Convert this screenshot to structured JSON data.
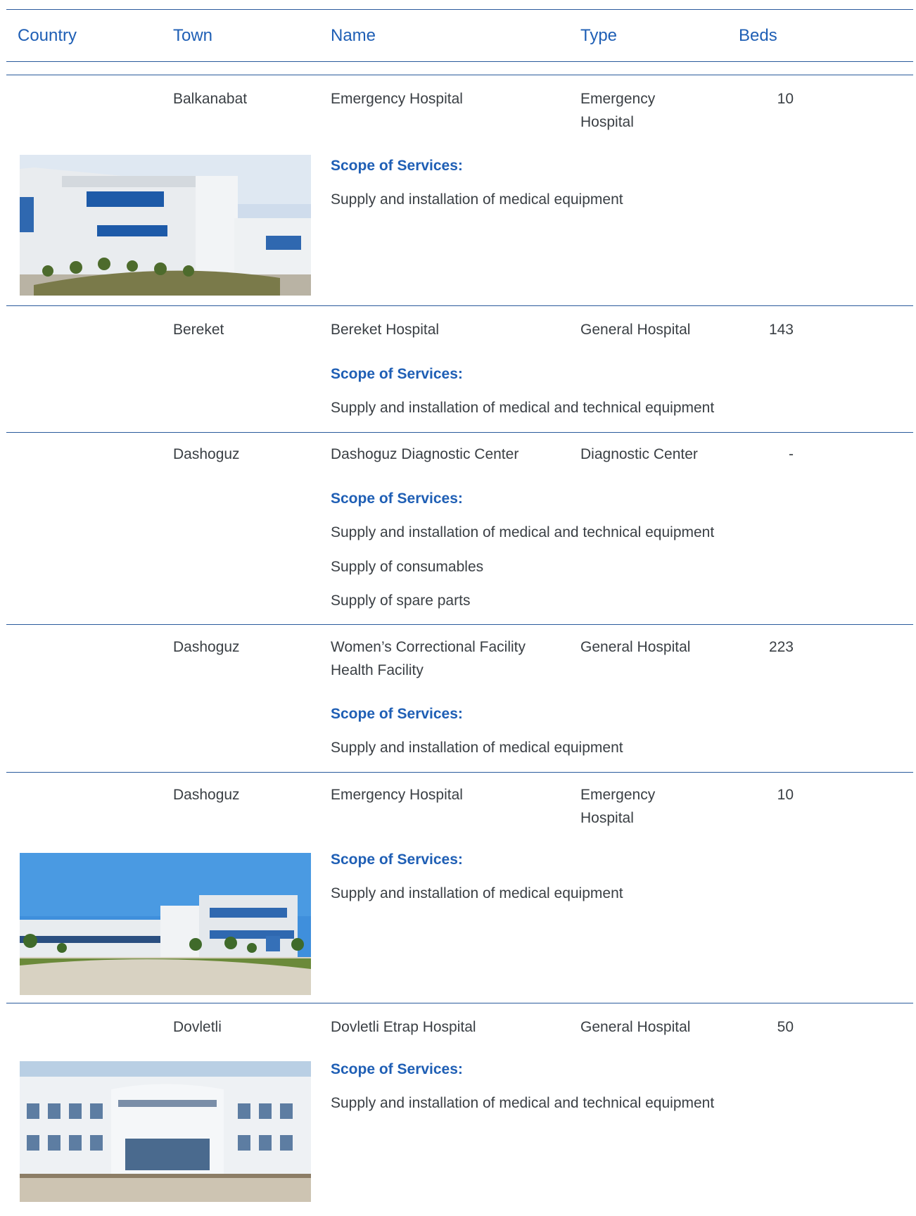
{
  "header": {
    "country": "Country",
    "town": "Town",
    "name": "Name",
    "type": "Type",
    "beds": "Beds"
  },
  "scope_heading": "Scope of Services:",
  "rows": [
    {
      "town": "Balkanabat",
      "name": "Emergency Hospital",
      "type": "Emergency Hospital",
      "beds": "10",
      "services": [
        "Supply and installation of medical equipment"
      ],
      "has_photo": true
    },
    {
      "town": "Bereket",
      "name": "Bereket Hospital",
      "type": "General Hospital",
      "beds": "143",
      "services": [
        "Supply and installation of medical and technical equipment"
      ],
      "has_photo": false
    },
    {
      "town": "Dashoguz",
      "name": "Dashoguz Diagnostic Center",
      "type": "Diagnostic Center",
      "beds": "-",
      "services": [
        "Supply and installation of medical and technical equipment",
        "Supply of consumables",
        "Supply of spare parts"
      ],
      "has_photo": false
    },
    {
      "town": "Dashoguz",
      "name": "Women’s Correctional Facility Health Facility",
      "type": "General Hospital",
      "beds": "223",
      "services": [
        "Supply and installation of medical equipment"
      ],
      "has_photo": false
    },
    {
      "town": "Dashoguz",
      "name": "Emergency Hospital",
      "type": "Emergency Hospital",
      "beds": "10",
      "services": [
        "Supply and installation of medical equipment"
      ],
      "has_photo": true
    },
    {
      "town": "Dovletli",
      "name": "Dovletli Etrap Hospital",
      "type": "General Hospital",
      "beds": "50",
      "services": [
        "Supply and installation of medical and technical equipment"
      ],
      "has_photo": true
    }
  ],
  "colors": {
    "accent": "#1f5fb5",
    "rule": "#2a5a9c",
    "text": "#3a3f44"
  }
}
